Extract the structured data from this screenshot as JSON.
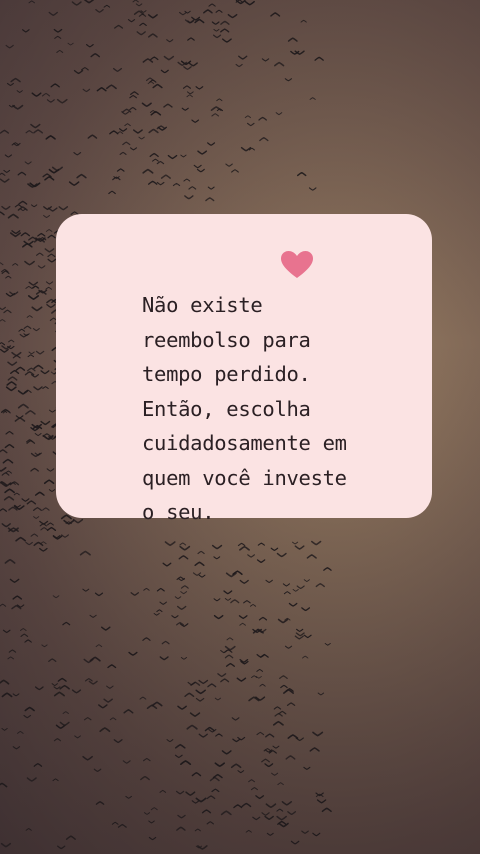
{
  "colors": {
    "card_background": "#fbe3e3",
    "heart": "#e8738f",
    "text": "#2b2024",
    "sky_center": "#9a7f63",
    "sky_edge": "#4a3a3b",
    "birds": "#1f1a1c"
  },
  "card": {
    "icon": "heart-icon",
    "quote": "Não existe\nreembolso para\ntempo perdido.\nEntão, escolha\ncuidadosamente em\nquem você investe\no seu."
  },
  "background": {
    "description_icon": "flock-of-birds"
  }
}
